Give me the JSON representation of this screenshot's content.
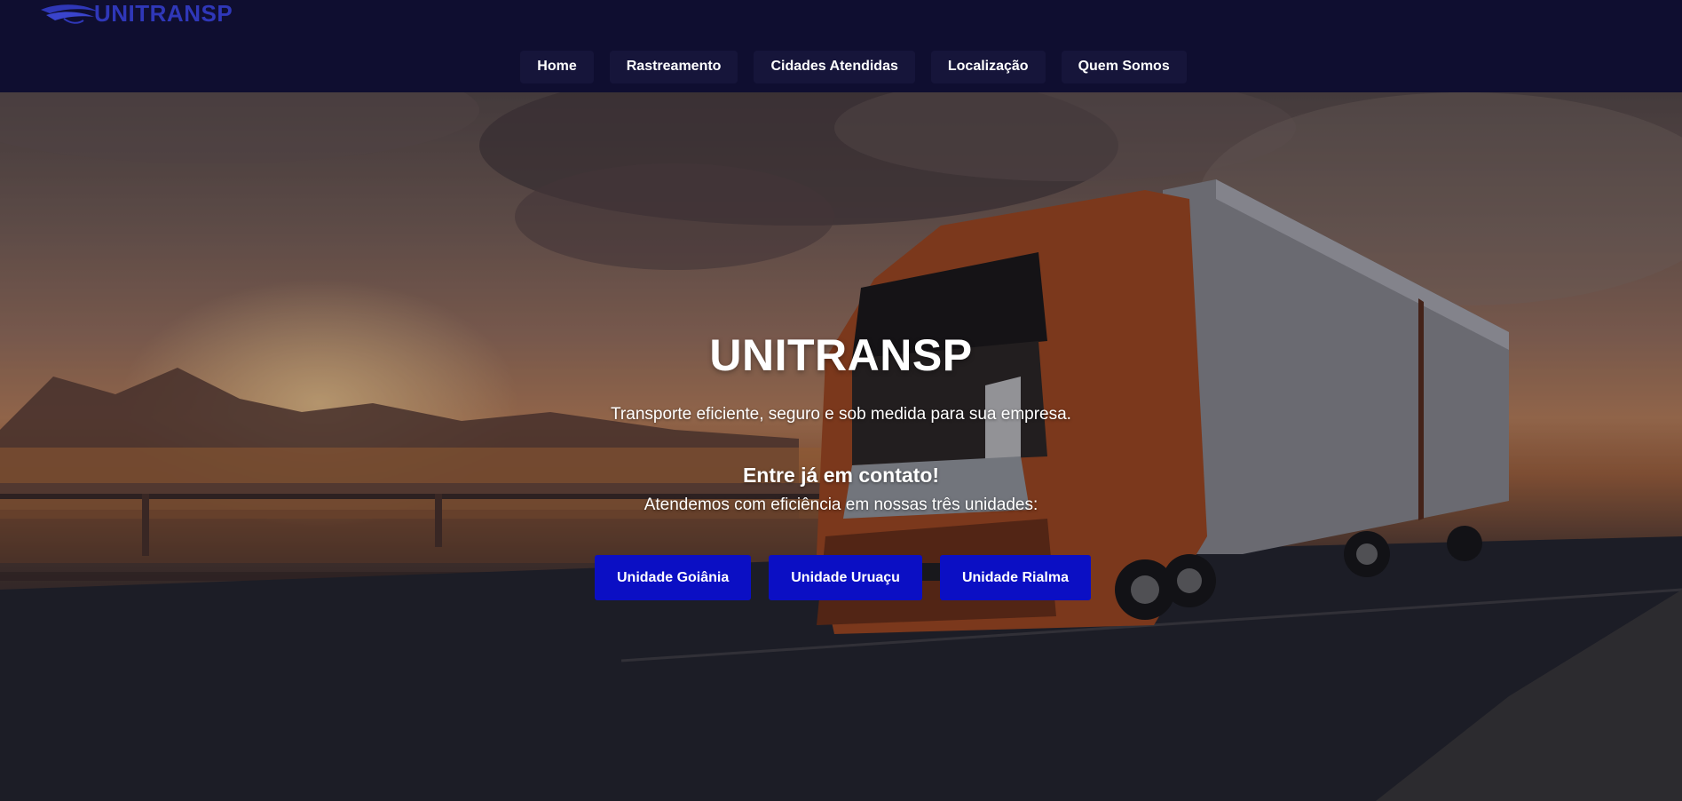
{
  "brand": {
    "logo_text": "UNITRANSP",
    "logo_icon": "wave-swoosh-icon",
    "logo_color": "#2f37b8"
  },
  "nav": {
    "items": [
      {
        "label": "Home"
      },
      {
        "label": "Rastreamento"
      },
      {
        "label": "Cidades Atendidas"
      },
      {
        "label": "Localização"
      },
      {
        "label": "Quem Somos"
      }
    ]
  },
  "hero": {
    "title": "UNITRANSP",
    "subtitle": "Transporte eficiente, seguro e sob medida para sua empresa.",
    "contact_title": "Entre já em contato!",
    "contact_subtitle": "Atendemos com eficiência em nossas três unidades:",
    "units": [
      {
        "label": "Unidade Goiânia"
      },
      {
        "label": "Unidade Uruaçu"
      },
      {
        "label": "Unidade Rialma"
      }
    ],
    "background_image": "orange-truck-on-highway-bridge-at-sunset"
  },
  "colors": {
    "header_bg": "#0f0e30",
    "button_bg": "#0b0fc4",
    "text": "#ffffff"
  }
}
